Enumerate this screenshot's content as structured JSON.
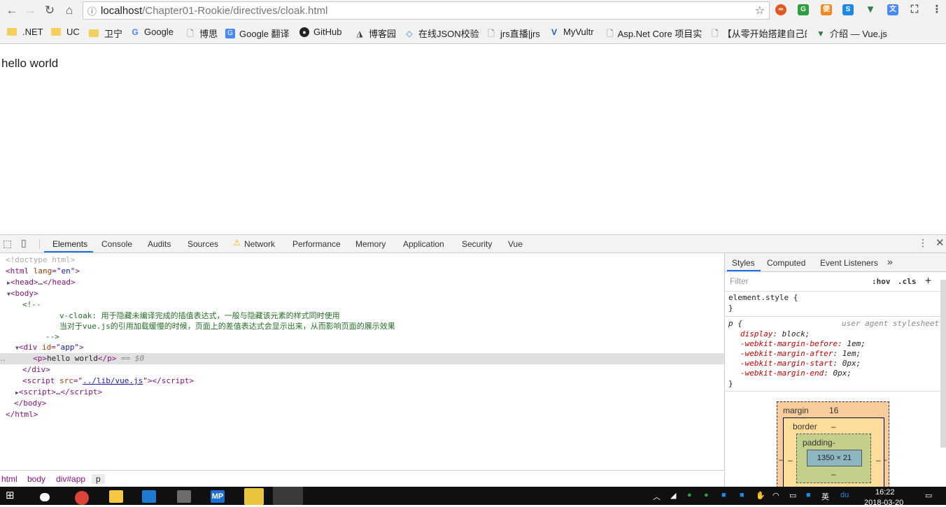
{
  "browser": {
    "url_host": "localhost",
    "url_path": "/Chapter01-Rookie/directives/cloak.html",
    "bookmarks": [
      {
        "label": ".NET",
        "icon": "folder-icon"
      },
      {
        "label": "UC",
        "icon": "folder-icon"
      },
      {
        "label": "卫宁",
        "icon": "folder-icon"
      },
      {
        "label": "Google",
        "icon": "google-icon"
      },
      {
        "label": "博思",
        "icon": "page-icon"
      },
      {
        "label": "Google 翻译",
        "icon": "translate-icon"
      },
      {
        "label": "GitHub",
        "icon": "github-icon"
      },
      {
        "label": "博客园",
        "icon": "cnblogs-icon"
      },
      {
        "label": "在线JSON校验",
        "icon": "json-icon"
      },
      {
        "label": "jrs直播|jrs",
        "icon": "page-icon"
      },
      {
        "label": "MyVultr",
        "icon": "vultr-icon"
      },
      {
        "label": "Asp.Net Core 项目实",
        "icon": "page-icon"
      },
      {
        "label": "【从零开始搭建自己的",
        "icon": "page-icon"
      },
      {
        "label": "介绍 — Vue.js",
        "icon": "vue-icon"
      }
    ]
  },
  "page": {
    "text": "hello world"
  },
  "devtools": {
    "tabs": [
      "Elements",
      "Console",
      "Audits",
      "Sources",
      "Network",
      "Performance",
      "Memory",
      "Application",
      "Security",
      "Vue"
    ],
    "active_tab": "Elements",
    "dom": {
      "doctype": "<!doctype html>",
      "html_open_tag": "html",
      "html_lang_attr": "lang",
      "html_lang_val": "\"en\"",
      "head": "head",
      "head_ellipsis": "…",
      "body": "body",
      "comment_open": "<!--",
      "comment_line1": "v-cloak: 用于隐藏未编译完成的插值表达式，一般与隐藏该元素的样式同时使用",
      "comment_line2": "当对于vue.js的引用加载缓慢的时候，页面上的差值表达式会显示出来，从而影响页面的展示效果",
      "comment_close": "-->",
      "div_tag": "div",
      "div_attr": "id",
      "div_val": "\"app\"",
      "p_tag": "p",
      "p_text": "hello world",
      "selected_marker": "== $0",
      "script_tag": "script",
      "script_attr": "src",
      "script_src": "../lib/vue.js",
      "script_ellipsis": "…",
      "div_close": "div",
      "body_close": "body",
      "html_close": "html"
    },
    "breadcrumbs": [
      "html",
      "body",
      "div#app",
      "p"
    ],
    "side_tabs": [
      "Styles",
      "Computed",
      "Event Listeners"
    ],
    "filter_placeholder": "Filter",
    "hov_label": ":hov",
    "cls_label": ".cls",
    "styles": {
      "element_style": "element.style {",
      "close_brace": "}",
      "p_selector": "p {",
      "ua_label": "user agent stylesheet",
      "rules": [
        {
          "prop": "display",
          "val": "block;"
        },
        {
          "prop": "-webkit-margin-before",
          "val": "1em;"
        },
        {
          "prop": "-webkit-margin-after",
          "val": "1em;"
        },
        {
          "prop": "-webkit-margin-start",
          "val": "0px;"
        },
        {
          "prop": "-webkit-margin-end",
          "val": "0px;"
        }
      ]
    },
    "box_model": {
      "margin_label": "margin",
      "margin_value": "16",
      "border_label": "border",
      "border_value": "–",
      "padding_label": "padding-",
      "content_size": "1350 × 21",
      "dash": "–"
    }
  },
  "taskbar": {
    "time": "16:22",
    "date": "2018-03-20",
    "ime": "英"
  },
  "colors": {
    "tag": "#881280",
    "attr_name": "#994500",
    "attr_value": "#1a1aa6",
    "comment": "#236e25",
    "active_tab_underline": "#1a73e8"
  }
}
